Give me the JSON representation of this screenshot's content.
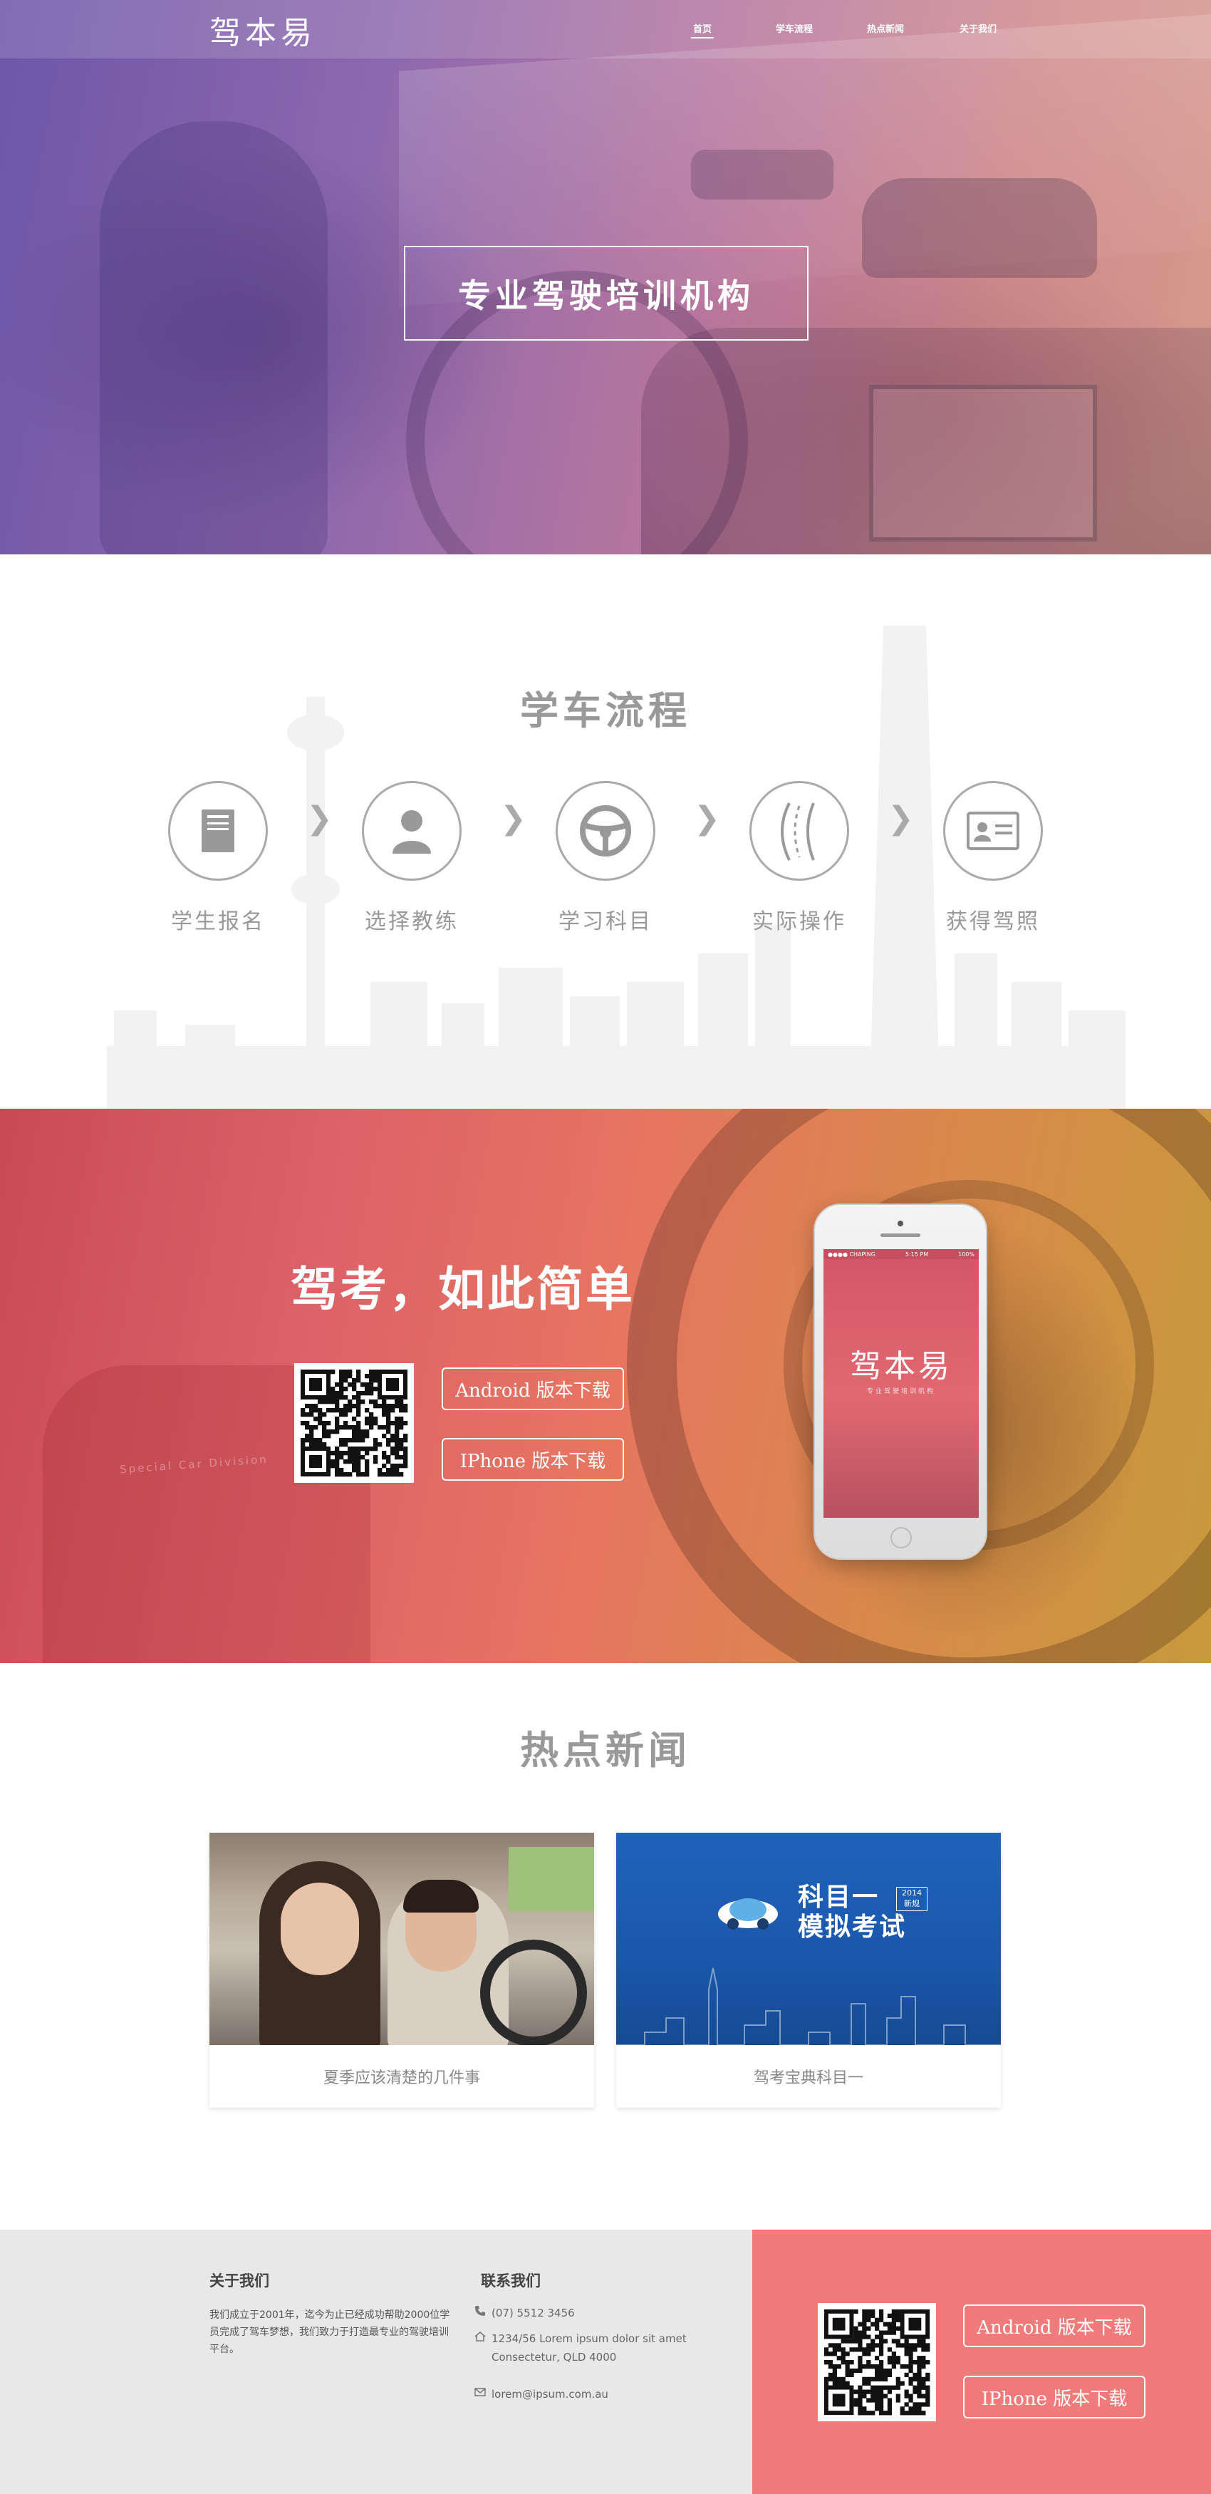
{
  "header": {
    "logo": "驾本易",
    "nav": [
      {
        "label": "首页",
        "active": true
      },
      {
        "label": "学车流程",
        "active": false
      },
      {
        "label": "热点新闻",
        "active": false
      },
      {
        "label": "关于我们",
        "active": false
      }
    ]
  },
  "hero": {
    "title": "专业驾驶培训机构"
  },
  "process": {
    "title": "学车流程",
    "steps": [
      {
        "label": "学生报名",
        "icon": "document-icon"
      },
      {
        "label": "选择教练",
        "icon": "person-icon"
      },
      {
        "label": "学习科目",
        "icon": "steering-wheel-icon"
      },
      {
        "label": "实际操作",
        "icon": "road-icon"
      },
      {
        "label": "获得驾照",
        "icon": "license-card-icon"
      }
    ],
    "arrow": "❯"
  },
  "promo": {
    "title": "驾考，如此简单",
    "android_label": "Android 版本下载",
    "iphone_label": "IPhone 版本下载",
    "seat_text": "Special Car Division",
    "phone": {
      "status_left": "●●●● CHAPING",
      "status_time": "5:15 PM",
      "status_right": "100%",
      "logo": "驾本易",
      "sub": "专业驾驶培训机构"
    }
  },
  "news": {
    "title": "热点新闻",
    "items": [
      {
        "caption": "夏季应该清楚的几件事"
      },
      {
        "caption": "驾考宝典科目一",
        "image_title_1": "科目一",
        "image_title_2": "模拟考试",
        "badge_1": "2014",
        "badge_2": "新规"
      }
    ]
  },
  "footer": {
    "about": {
      "heading": "关于我们",
      "text": "我们成立于2001年，迄今为止已经成功帮助2000位学员完成了驾车梦想，我们致力于打造最专业的驾驶培训平台。"
    },
    "contact": {
      "heading": "联系我们",
      "phone": "(07) 5512 3456",
      "address_1": "1234/56 Lorem ipsum dolor sit amet",
      "address_2": "Consectetur, QLD 4000",
      "email": "lorem@ipsum.com.au"
    },
    "android_label": "Android 版本下载",
    "iphone_label": "IPhone 版本下载"
  },
  "colors": {
    "hero_gradient_left": "#6e56a8",
    "hero_gradient_right": "#d79a8c",
    "promo_gradient_left": "#c94a55",
    "promo_gradient_right": "#c79a3c",
    "footer_accent": "#f07b7b",
    "footer_bg": "#e8e8e8"
  }
}
